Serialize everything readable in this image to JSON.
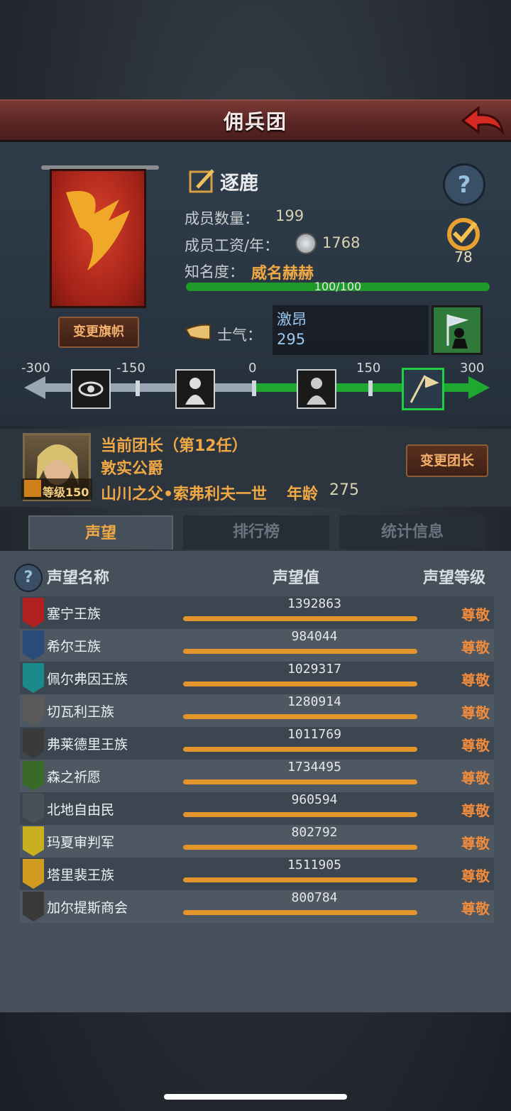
{
  "header": {
    "title": "佣兵团"
  },
  "banner": {
    "change_label": "变更旗帜"
  },
  "guild": {
    "name": "逐鹿",
    "members_label": "成员数量：",
    "members_value": "199",
    "wage_label": "成员工资/年：",
    "wage_value": "1768",
    "fame_label": "知名度：",
    "fame_value": "威名赫赫",
    "fame_progress": "100/100",
    "badge_value": "78",
    "morale_label": "士气：",
    "morale_state": "激昂",
    "morale_value": "295"
  },
  "morale_scale": {
    "ticks": [
      "-300",
      "-150",
      "0",
      "150",
      "300"
    ]
  },
  "leader": {
    "title": "当前团长（第12任）",
    "rank": "敦实公爵",
    "level": "等级150",
    "name": "山川之父•索弗利夫一世",
    "age_label": "年龄",
    "age": "275",
    "change_label": "变更团长"
  },
  "tabs": [
    {
      "label": "声望"
    },
    {
      "label": "排行榜"
    },
    {
      "label": "统计信息"
    }
  ],
  "table": {
    "headers": [
      "声望名称",
      "声望值",
      "声望等级"
    ],
    "rows": [
      {
        "name": "塞宁王族",
        "value": "1392863",
        "level": "尊敬",
        "color": "#b02020"
      },
      {
        "name": "希尔王族",
        "value": "984044",
        "level": "尊敬",
        "color": "#2a4a7a"
      },
      {
        "name": "佩尔弗因王族",
        "value": "1029317",
        "level": "尊敬",
        "color": "#1a8a8a"
      },
      {
        "name": "切瓦利王族",
        "value": "1280914",
        "level": "尊敬",
        "color": "#5a5a5a"
      },
      {
        "name": "弗莱德里王族",
        "value": "1011769",
        "level": "尊敬",
        "color": "#3a3a3a"
      },
      {
        "name": "森之祈愿",
        "value": "1734495",
        "level": "尊敬",
        "color": "#3a6a2a"
      },
      {
        "name": "北地自由民",
        "value": "960594",
        "level": "尊敬",
        "color": "#4a5058"
      },
      {
        "name": "玛夏审判军",
        "value": "802792",
        "level": "尊敬",
        "color": "#c8b020"
      },
      {
        "name": "塔里裴王族",
        "value": "1511905",
        "level": "尊敬",
        "color": "#d09a20"
      },
      {
        "name": "加尔提斯商会",
        "value": "800784",
        "level": "尊敬",
        "color": "#3a3a3a"
      }
    ]
  }
}
